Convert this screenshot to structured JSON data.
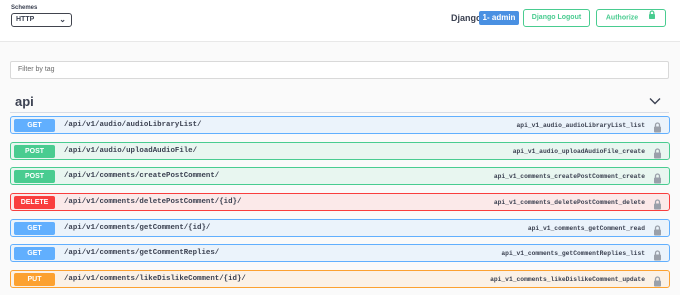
{
  "header": {
    "schemes_label": "Schemes",
    "scheme_selected": "HTTP",
    "django_label": "Django",
    "user_badge": "1- admin",
    "logout_label": "Django Logout",
    "authorize_label": "Authorize"
  },
  "filter": {
    "placeholder": "Filter by tag"
  },
  "section": {
    "title": "api"
  },
  "operations": [
    {
      "method": "GET",
      "path": "/api/v1/audio/audioLibraryList/",
      "operation_id": "api_v1_audio_audioLibraryList_list"
    },
    {
      "method": "POST",
      "path": "/api/v1/audio/uploadAudioFile/",
      "operation_id": "api_v1_audio_uploadAudioFile_create"
    },
    {
      "method": "POST",
      "path": "/api/v1/comments/createPostComment/",
      "operation_id": "api_v1_comments_createPostComment_create"
    },
    {
      "method": "DELETE",
      "path": "/api/v1/comments/deletePostComment/{id}/",
      "operation_id": "api_v1_comments_deletePostComment_delete"
    },
    {
      "method": "GET",
      "path": "/api/v1/comments/getComment/{id}/",
      "operation_id": "api_v1_comments_getComment_read"
    },
    {
      "method": "GET",
      "path": "/api/v1/comments/getCommentReplies/",
      "operation_id": "api_v1_comments_getCommentReplies_list"
    },
    {
      "method": "PUT",
      "path": "/api/v1/comments/likeDislikeComment/{id}/",
      "operation_id": "api_v1_comments_likeDislikeComment_update"
    }
  ],
  "colors": {
    "get": "#61affe",
    "post": "#49cc90",
    "delete": "#f93e3e",
    "put": "#fca130",
    "badge": "#4990e2"
  }
}
